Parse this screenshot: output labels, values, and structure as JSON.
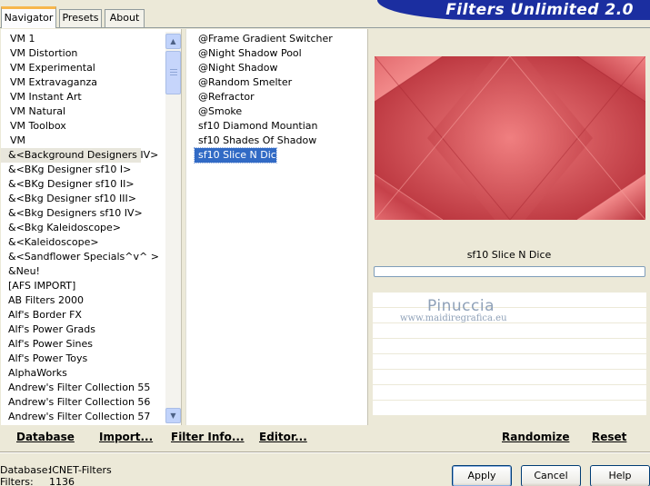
{
  "tabs": [
    {
      "label": "Navigator"
    },
    {
      "label": "Presets"
    },
    {
      "label": "About"
    }
  ],
  "banner": {
    "title": "Filters Unlimited 2.0"
  },
  "categories": [
    "VM 1",
    "VM Distortion",
    "VM Experimental",
    "VM Extravaganza",
    "VM Instant Art",
    "VM Natural",
    "VM Toolbox",
    "VM",
    "&<Background Designers IV>",
    "&<BKg Designer sf10 I>",
    "&<BKg Designer sf10 II>",
    "&<Bkg Designer sf10 III>",
    "&<Bkg Designers sf10 IV>",
    "&<Bkg Kaleidoscope>",
    "&<Kaleidoscope>",
    "&<Sandflower Specials^v^ >",
    "&Neu!",
    "[AFS IMPORT]",
    "AB Filters 2000",
    "Alf's Border FX",
    "Alf's Power Grads",
    "Alf's Power Sines",
    "Alf's Power Toys",
    "AlphaWorks",
    "Andrew's Filter Collection 55",
    "Andrew's Filter Collection 56",
    "Andrew's Filter Collection 57"
  ],
  "filters": [
    "@Frame Gradient Switcher",
    "@Night Shadow Pool",
    "@Night Shadow",
    "@Random Smelter",
    "@Refractor",
    "@Smoke",
    "sf10 Diamond Mountian",
    "sf10 Shades Of Shadow",
    "sf10 Slice N Dice"
  ],
  "selected_filter_name": "sf10 Slice N Dice",
  "watermark": {
    "name": "Pinuccia",
    "url": "www.maidiregrafica.eu"
  },
  "actions": {
    "database": "Database",
    "import": "Import...",
    "filter_info": "Filter Info...",
    "editor": "Editor...",
    "randomize": "Randomize",
    "reset": "Reset"
  },
  "status": {
    "database_label": "Database:",
    "database_value": "ICNET-Filters",
    "filters_label": "Filters:",
    "filters_value": "1136"
  },
  "buttons": {
    "apply": "Apply",
    "cancel": "Cancel",
    "help": "Help"
  },
  "colors": {
    "banner": "#1b2ea0",
    "selection": "#316ac5",
    "preview_base": "#c94850"
  }
}
